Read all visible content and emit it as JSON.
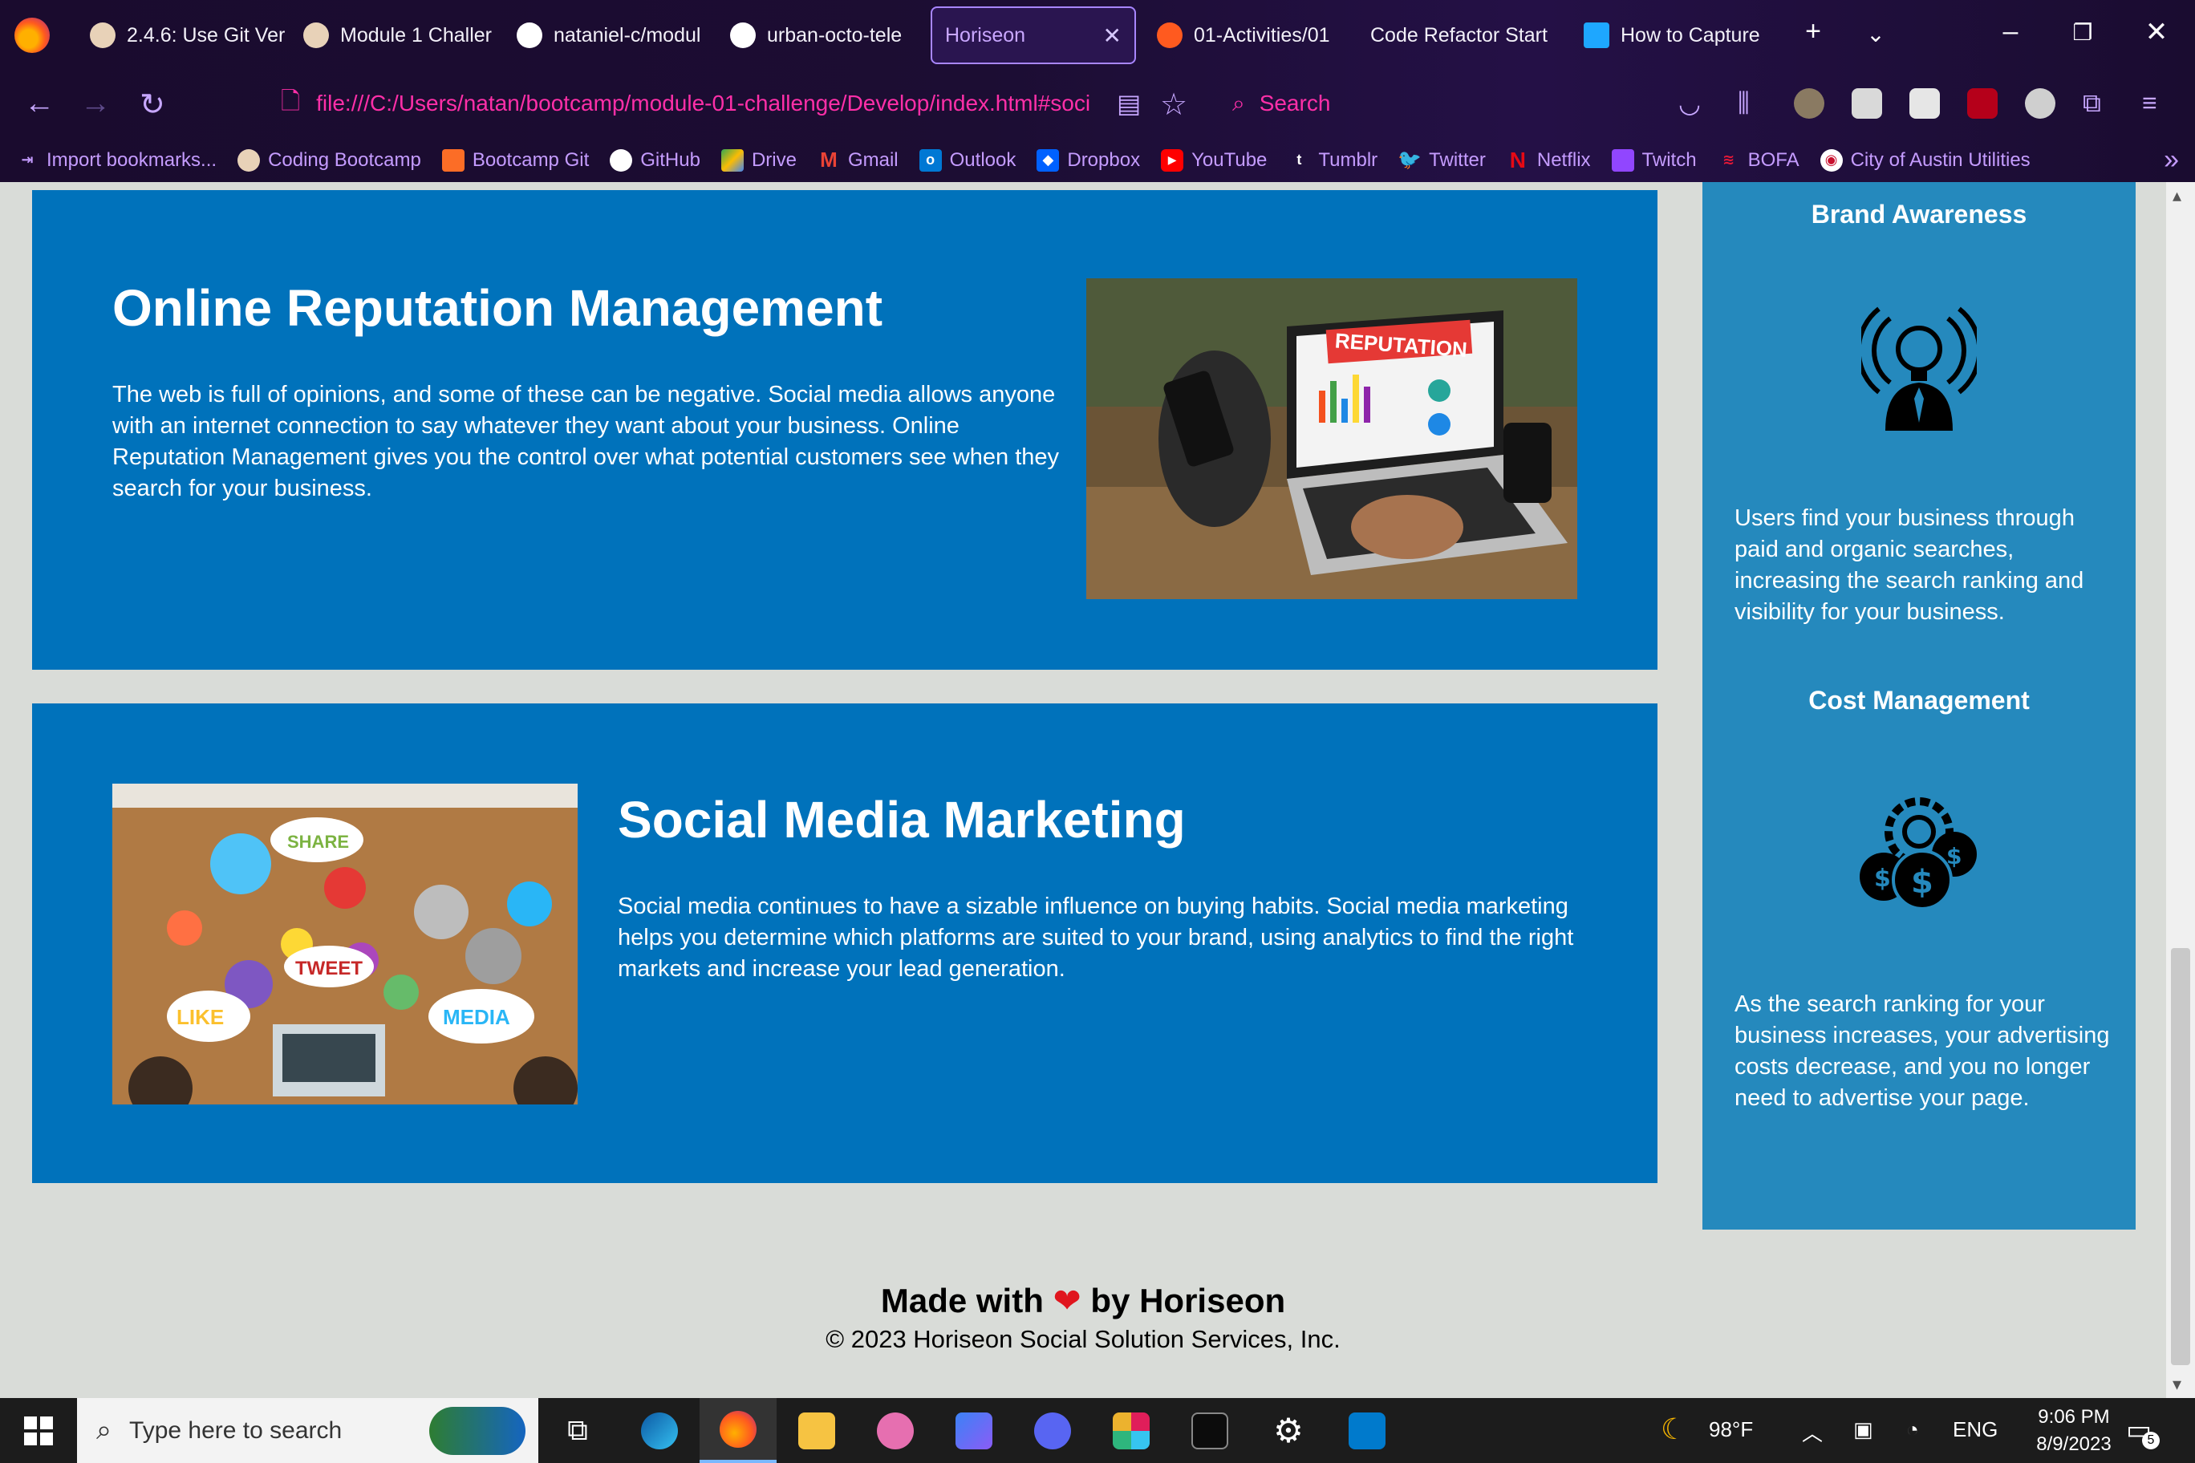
{
  "browser": {
    "tabs": [
      {
        "label": "2.4.6: Use Git Ver",
        "active": false
      },
      {
        "label": "Module 1 Challer",
        "active": false
      },
      {
        "label": "nataniel-c/modul",
        "active": false
      },
      {
        "label": "urban-octo-tele",
        "active": false
      },
      {
        "label": "Horiseon",
        "active": true
      },
      {
        "label": "01-Activities/01",
        "active": false
      },
      {
        "label": "Code Refactor Start",
        "active": false
      },
      {
        "label": "How to Capture",
        "active": false
      }
    ],
    "url": "file:///C:/Users/natan/bootcamp/module-01-challenge/Develop/index.html#soci",
    "search_placeholder": "Search",
    "bookmarks": [
      {
        "label": "Import bookmarks...",
        "icon": "import-icon",
        "color": "#8a6cff"
      },
      {
        "label": "Coding Bootcamp",
        "icon": "bootcamp-icon",
        "color": "#e8d2b8"
      },
      {
        "label": "Bootcamp Git",
        "icon": "gitlab-icon",
        "color": "#fc6d26"
      },
      {
        "label": "GitHub",
        "icon": "github-icon",
        "color": "#ffffff"
      },
      {
        "label": "Drive",
        "icon": "drive-icon",
        "color": "#34a853"
      },
      {
        "label": "Gmail",
        "icon": "gmail-icon",
        "color": "#ea4335"
      },
      {
        "label": "Outlook",
        "icon": "outlook-icon",
        "color": "#0078d4"
      },
      {
        "label": "Dropbox",
        "icon": "dropbox-icon",
        "color": "#0061ff"
      },
      {
        "label": "YouTube",
        "icon": "youtube-icon",
        "color": "#ff0000"
      },
      {
        "label": "Tumblr",
        "icon": "tumblr-icon",
        "color": "#35465c"
      },
      {
        "label": "Twitter",
        "icon": "twitter-icon",
        "color": "#1da1f2"
      },
      {
        "label": "Netflix",
        "icon": "netflix-icon",
        "color": "#e50914"
      },
      {
        "label": "Twitch",
        "icon": "twitch-icon",
        "color": "#9146ff"
      },
      {
        "label": "BOFA",
        "icon": "bofa-icon",
        "color": "#e31837"
      },
      {
        "label": "City of Austin Utilities",
        "icon": "austin-icon",
        "color": "#c8102e"
      }
    ]
  },
  "page": {
    "reputation": {
      "title": "Online Reputation Management",
      "body": "The web is full of opinions, and some of these can be negative. Social media allows anyone with an internet connection to say whatever they want about your business. Online Reputation Management gives you the control over what potential customers see when they search for your business.",
      "image_text": "REPUTATION"
    },
    "social": {
      "title": "Social Media Marketing",
      "body": "Social media continues to have a sizable influence on buying habits. Social media marketing helps you determine which platforms are suited to your brand, using analytics to find the right markets and increase your lead generation.",
      "image_words": [
        "SHARE",
        "TWEET",
        "LIKE",
        "MEDIA"
      ]
    },
    "aside": {
      "brand": {
        "title": "Brand Awareness",
        "body": "Users find your business through paid and organic searches, increasing the search ranking and visibility for your business."
      },
      "cost": {
        "title": "Cost Management",
        "body": "As the search ranking for your business increases, your advertising costs decrease, and you no longer need to advertise your page."
      }
    },
    "footer": {
      "made_with_prefix": "Made with",
      "made_with_suffix": "by Horiseon",
      "copyright": "© 2023 Horiseon Social Solution Services, Inc."
    }
  },
  "taskbar": {
    "search_placeholder": "Type here to search",
    "weather": "98°F",
    "language": "ENG",
    "time": "9:06 PM",
    "date": "8/9/2023",
    "notification_count": "5"
  },
  "colors": {
    "section_bg": "#0072bb",
    "aside_bg": "#2589bd",
    "page_bg": "#d9dcd8",
    "accent_pink": "#ff2fa8"
  }
}
